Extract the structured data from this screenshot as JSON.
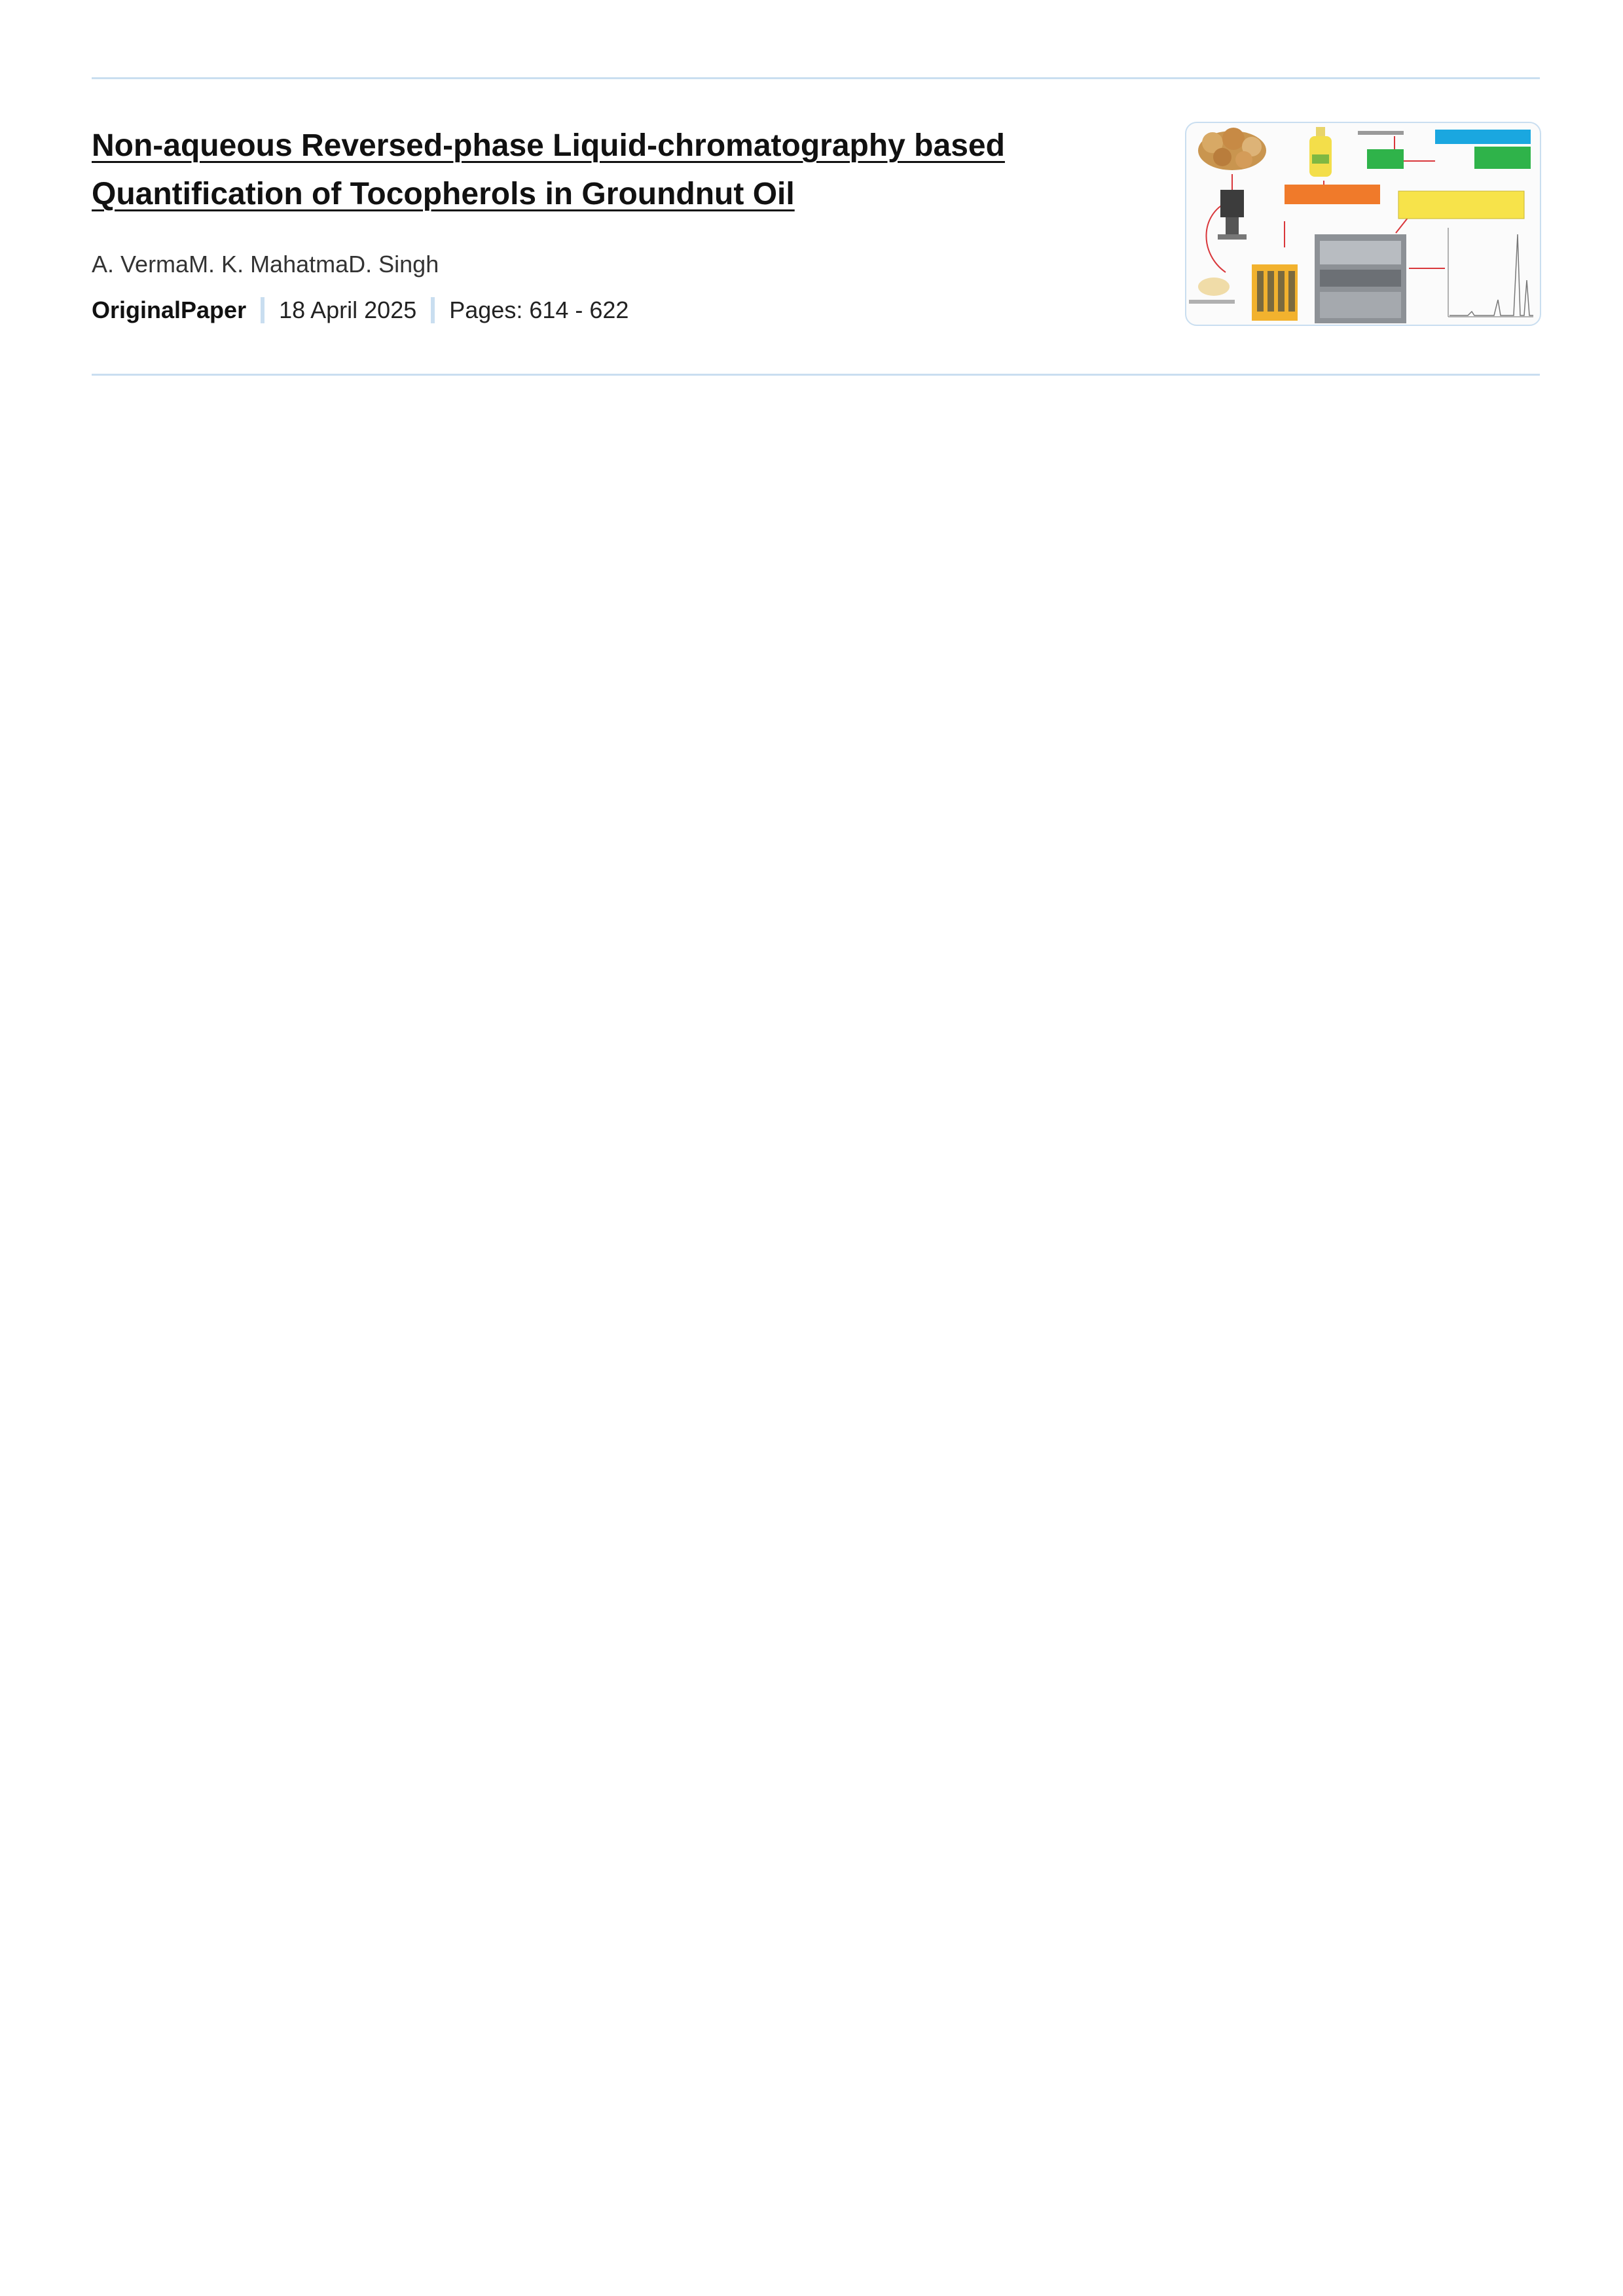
{
  "article": {
    "title": "Non-aqueous Reversed-phase Liquid-chromatography based Quantification of Tocopherols in Groundnut Oil",
    "authors": [
      "A. Verma",
      "M. K. Mahatma",
      "D. Singh"
    ],
    "type": "OriginalPaper",
    "date": "18 April 2025",
    "pages": "Pages: 614 - 622",
    "thumbnail": {
      "icon": "graphical-abstract-image",
      "colors": {
        "accent_rule": "#c9def0",
        "orange_box": "#f07a2a",
        "green_box": "#2fb34a",
        "blue_box": "#1aa7e0",
        "yellow_box": "#f7e34a",
        "arrow": "#d9373b"
      }
    }
  }
}
